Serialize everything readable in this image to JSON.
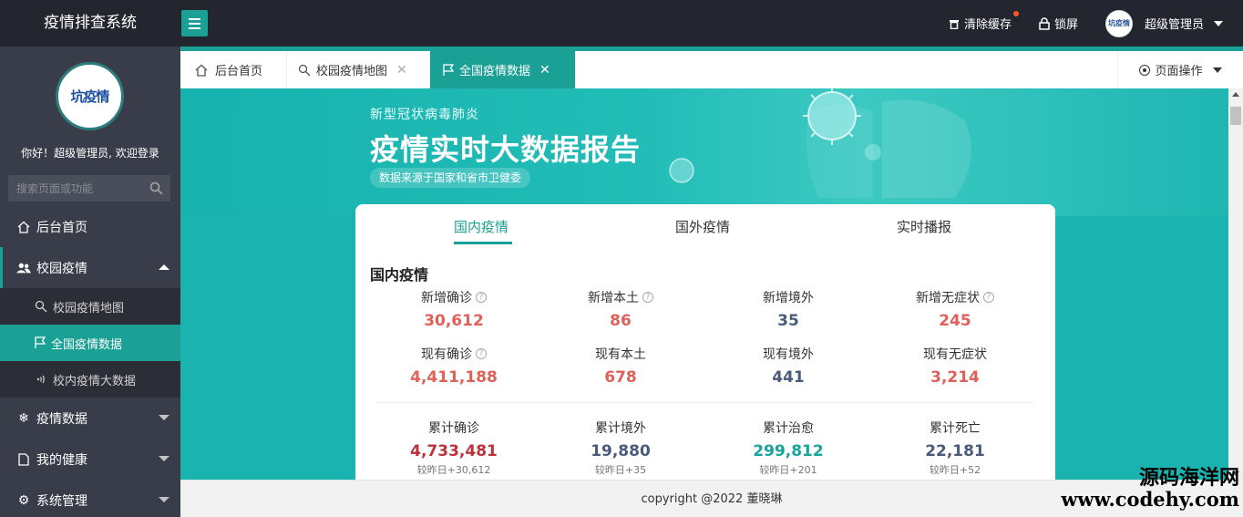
{
  "header": {
    "app_title": "疫情排查系统",
    "clear_cache": "清除缓存",
    "lock_screen": "锁屏",
    "user_name": "超级管理员",
    "avatar_text": "坑疫情"
  },
  "sidebar": {
    "logo_text": "坑疫情",
    "welcome": "你好！超级管理员, 欢迎登录",
    "search_placeholder": "搜索页面或功能",
    "items": [
      {
        "label": "后台首页"
      },
      {
        "label": "校园疫情"
      },
      {
        "label": "疫情数据"
      },
      {
        "label": "我的健康"
      },
      {
        "label": "系统管理"
      }
    ],
    "sub_items": [
      {
        "label": "校园疫情地图"
      },
      {
        "label": "全国疫情数据"
      },
      {
        "label": "校内疫情大数据"
      }
    ]
  },
  "tabs": {
    "items": [
      {
        "label": "后台首页"
      },
      {
        "label": "校园疫情地图"
      },
      {
        "label": "全国疫情数据"
      }
    ],
    "page_ops": "页面操作"
  },
  "banner": {
    "subtitle": "新型冠状病毒肺炎",
    "title": "疫情实时大数据报告",
    "source": "数据来源于国家和省市卫健委"
  },
  "card": {
    "tabs": [
      "国内疫情",
      "国外疫情",
      "实时播报"
    ],
    "section_title": "国内疫情",
    "row1": [
      {
        "label": "新增确诊",
        "value": "30,612"
      },
      {
        "label": "新增本土",
        "value": "86"
      },
      {
        "label": "新增境外",
        "value": "35"
      },
      {
        "label": "新增无症状",
        "value": "245"
      }
    ],
    "row2": [
      {
        "label": "现有确诊",
        "value": "4,411,188"
      },
      {
        "label": "现有本土",
        "value": "678"
      },
      {
        "label": "现有境外",
        "value": "441"
      },
      {
        "label": "现有无症状",
        "value": "3,214"
      }
    ],
    "row3": [
      {
        "label": "累计确诊",
        "value": "4,733,481",
        "compare": "较昨日+30,612"
      },
      {
        "label": "累计境外",
        "value": "19,880",
        "compare": "较昨日+35"
      },
      {
        "label": "累计治愈",
        "value": "299,812",
        "compare": "较昨日+201"
      },
      {
        "label": "累计死亡",
        "value": "22,181",
        "compare": "较昨日+52"
      }
    ]
  },
  "colors": {
    "accent": "#1aa094",
    "red": "#e0605a",
    "navy": "#4a5a7a",
    "dark_red": "#c0303a",
    "teal": "#17a39a"
  },
  "footer": {
    "copyright": "copyright @2022 董晓琳"
  },
  "watermark": {
    "name": "源码海洋网",
    "url": "www.codehy.com"
  }
}
